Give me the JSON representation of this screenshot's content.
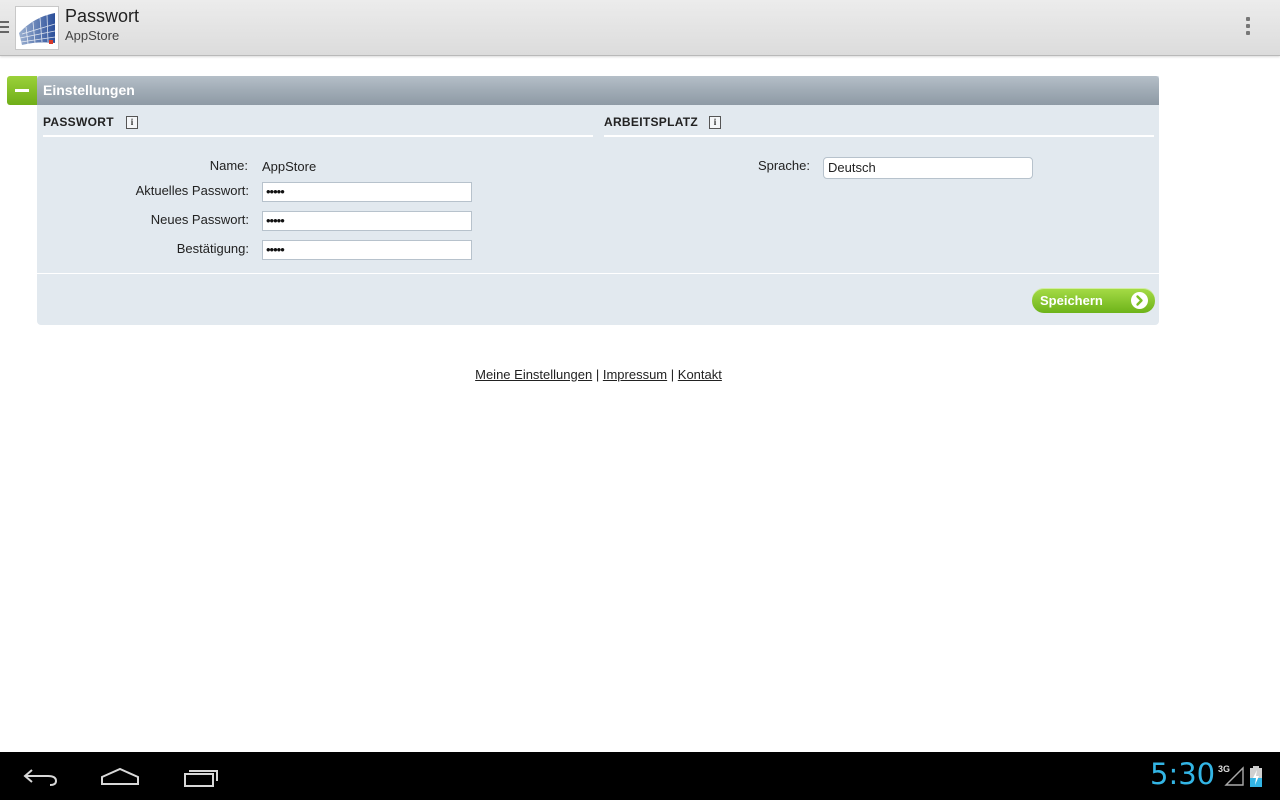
{
  "actionbar": {
    "title": "Passwort",
    "subtitle": "AppStore",
    "drawer_icon": "menu-icon",
    "logo_icon": "app-logo",
    "overflow_icon": "overflow-menu-icon"
  },
  "panel": {
    "title": "Einstellungen",
    "collapse_icon": "minus-icon",
    "accent_color": "#7dbf22",
    "password_section": {
      "title": "PASSWORT",
      "info_icon": "i",
      "name_label": "Name:",
      "name_value": "AppStore",
      "current_label": "Aktuelles Passwort:",
      "current_value": "•••••",
      "new_label": "Neues Passwort:",
      "new_value": "•••••",
      "confirm_label": "Bestätigung:",
      "confirm_value": "•••••"
    },
    "workplace_section": {
      "title": "ARBEITSPLATZ",
      "info_icon": "i",
      "language_label": "Sprache:",
      "language_value": "Deutsch"
    },
    "save_label": "Speichern",
    "save_icon": "arrow-right-circle-icon"
  },
  "footer": {
    "link1": "Meine Einstellungen",
    "link2": "Impressum",
    "link3": "Kontakt",
    "separator": "|"
  },
  "systembar": {
    "clock": "5:30",
    "network": "3G",
    "clock_color": "#33b5e5",
    "back_icon": "back-icon",
    "home_icon": "home-icon",
    "recents_icon": "recent-apps-icon"
  }
}
